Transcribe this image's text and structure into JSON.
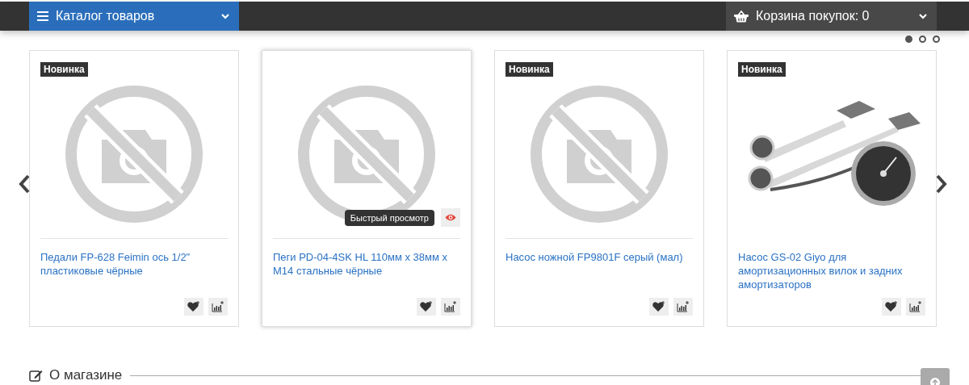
{
  "top_bar": {
    "catalog_button": "Каталог товаров",
    "cart_button": "Корзина покупок: 0"
  },
  "new_section": {
    "dots": [
      {
        "selected": true
      },
      {
        "selected": false
      },
      {
        "selected": false
      }
    ],
    "products": [
      {
        "badge": "Новинка",
        "kind": "placeholder",
        "title": "Педали FP-628 Feimin ось 1/2\" пластиковые чёрные",
        "hovered": false
      },
      {
        "kind": "placeholder",
        "title": "Пеги PD-04-4SK HL 110мм x 38мм x M14 стальные чёрные",
        "hovered": true,
        "quick_view_tooltip": "Быстрый просмотр"
      },
      {
        "badge": "Новинка",
        "kind": "placeholder",
        "title": "Насос ножной FP9801F серый (мал)",
        "hovered": false
      },
      {
        "badge": "Новинка",
        "kind": "picture",
        "title": "Насос GS-02 Giyo для амортизационных вилок и задних амортизаторов",
        "hovered": false
      }
    ]
  },
  "about_section": {
    "title": "О магазине"
  }
}
